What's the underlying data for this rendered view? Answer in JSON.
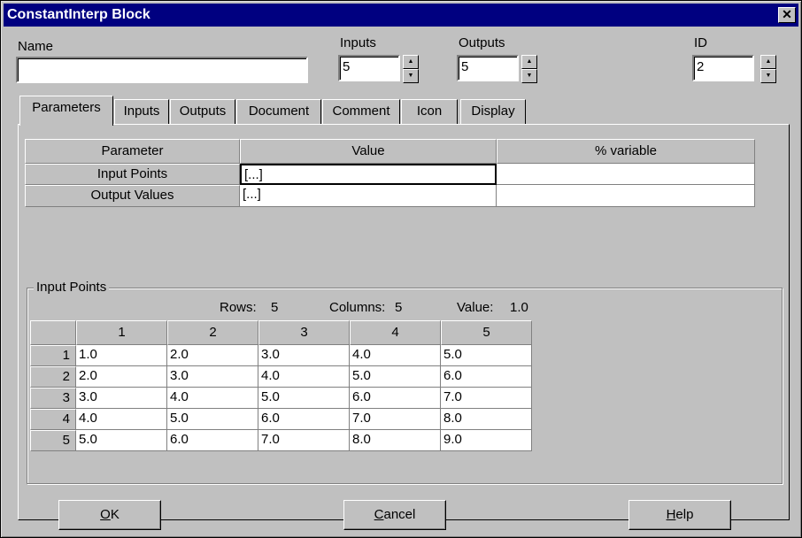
{
  "window": {
    "title": "ConstantInterp Block",
    "close_glyph": "✕"
  },
  "name": {
    "label": "Name",
    "value": ""
  },
  "inputs": {
    "label": "Inputs",
    "value": "5"
  },
  "outputs": {
    "label": "Outputs",
    "value": "5"
  },
  "id": {
    "label": "ID",
    "value": "2"
  },
  "tabs": [
    "Parameters",
    "Inputs",
    "Outputs",
    "Document",
    "Comment",
    "Icon",
    "Display"
  ],
  "param_table": {
    "headers": [
      "Parameter",
      "Value",
      "% variable"
    ],
    "rows": [
      {
        "name": "Input Points",
        "value": "[...]",
        "variable": ""
      },
      {
        "name": "Output Values",
        "value": "[...]",
        "variable": ""
      }
    ]
  },
  "input_points": {
    "group_title": "Input Points",
    "rows_label": "Rows:",
    "rows_value": "5",
    "cols_label": "Columns:",
    "cols_value": "5",
    "val_label": "Value:",
    "val_value": "1.0",
    "col_headers": [
      "1",
      "2",
      "3",
      "4",
      "5"
    ],
    "row_headers": [
      "1",
      "2",
      "3",
      "4",
      "5"
    ],
    "cells": [
      [
        "1.0",
        "2.0",
        "3.0",
        "4.0",
        "5.0"
      ],
      [
        "2.0",
        "3.0",
        "4.0",
        "5.0",
        "6.0"
      ],
      [
        "3.0",
        "4.0",
        "5.0",
        "6.0",
        "7.0"
      ],
      [
        "4.0",
        "5.0",
        "6.0",
        "7.0",
        "8.0"
      ],
      [
        "5.0",
        "6.0",
        "7.0",
        "8.0",
        "9.0"
      ]
    ]
  },
  "buttons": {
    "ok": {
      "accel": "O",
      "rest": "K"
    },
    "cancel": {
      "accel": "C",
      "rest": "ancel"
    },
    "help": {
      "accel": "H",
      "rest": "elp"
    }
  },
  "spinner_glyphs": {
    "up": "▲",
    "down": "▼"
  }
}
